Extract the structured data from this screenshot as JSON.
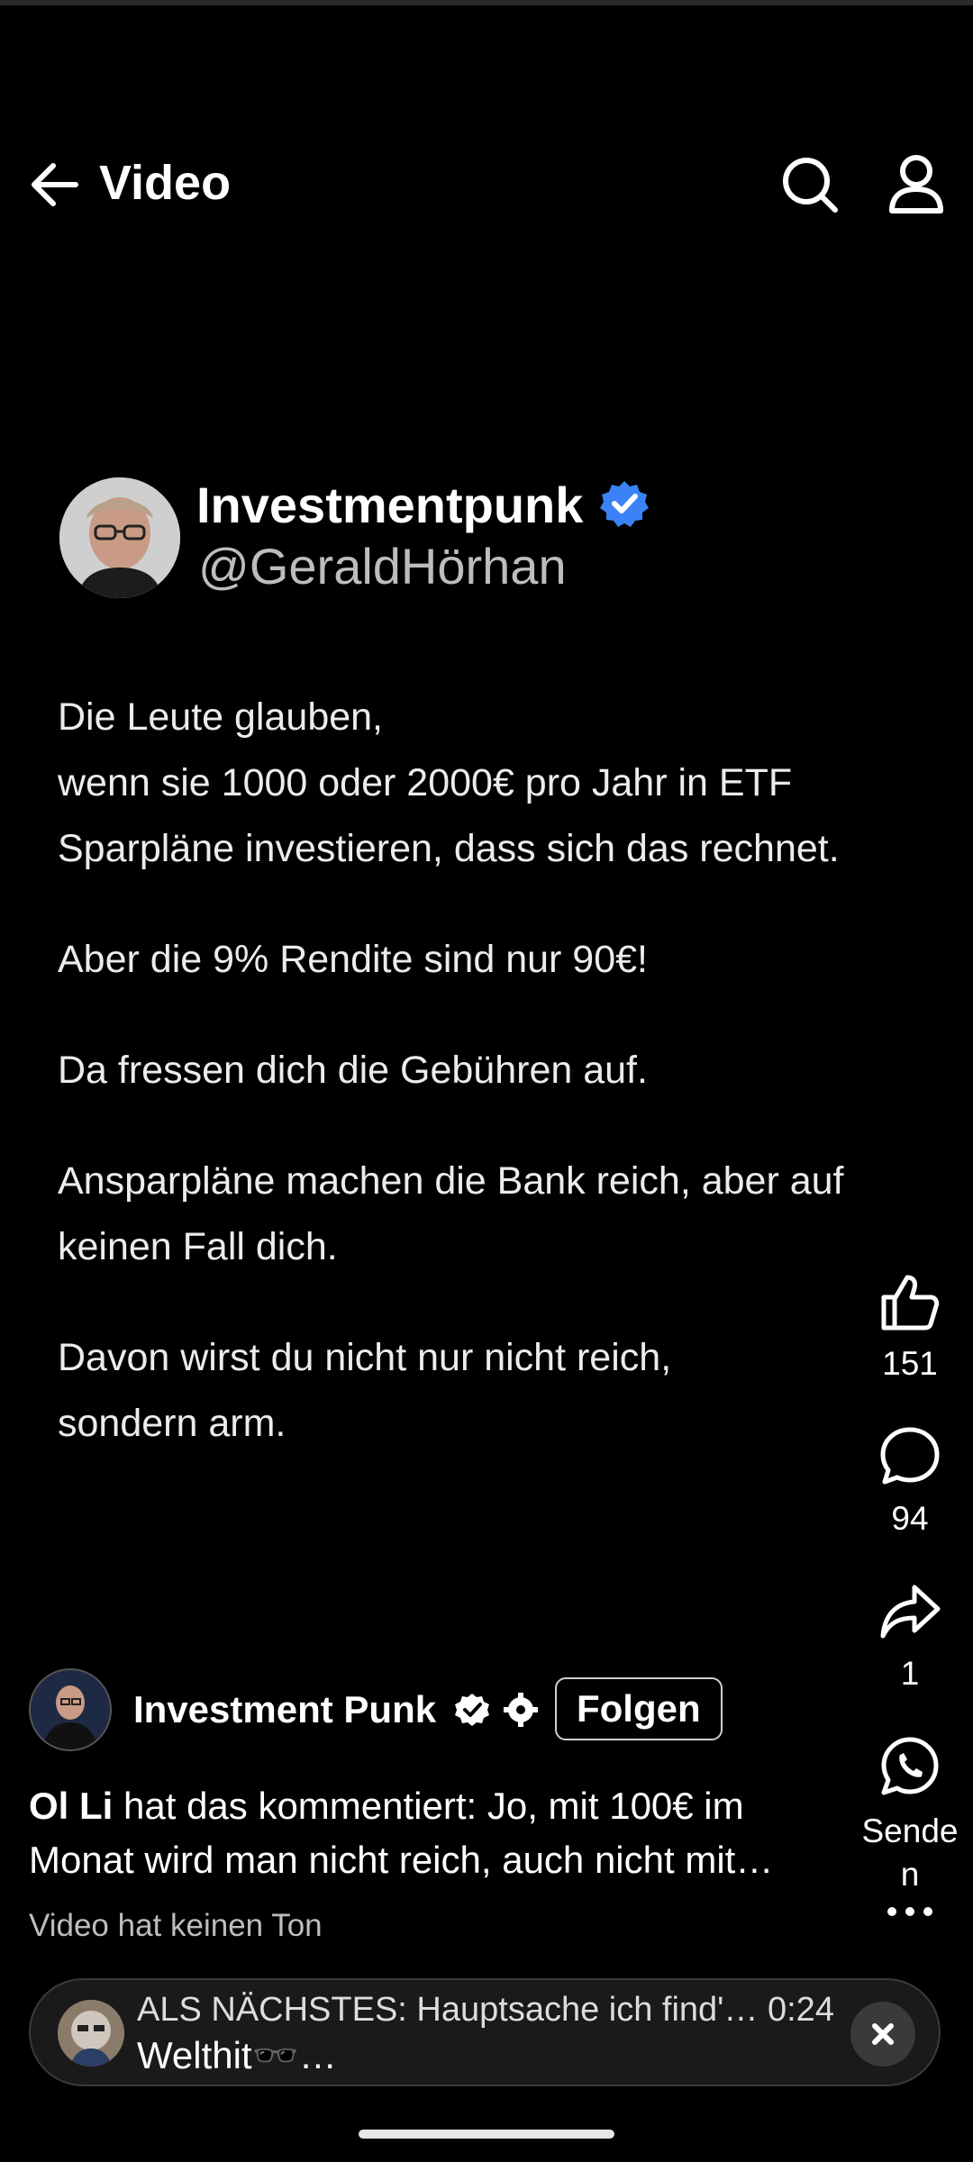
{
  "header": {
    "title": "Video",
    "icons": [
      "back-arrow-icon",
      "search-icon",
      "profile-icon"
    ]
  },
  "post": {
    "author_name": "Investmentpunk",
    "handle": "@GeraldHörhan",
    "paragraphs": [
      "Die Leute glauben,",
      "wenn sie 1000 oder 2000€ pro Jahr in ETF Sparpläne investieren, dass sich das rechnet.",
      "Aber die 9% Rendite sind nur 90€!",
      "Da fressen dich die Gebühren auf.",
      "Ansparpläne machen die Bank reich, aber auf keinen Fall dich.",
      "Davon wirst du nicht nur nicht reich,",
      "sondern arm."
    ]
  },
  "actions": {
    "likes": "151",
    "comments": "94",
    "shares": "1",
    "send_label": "Sende\nn"
  },
  "channel": {
    "name": "Investment Punk",
    "follow_label": "Folgen"
  },
  "comment": {
    "author": "Ol Li",
    "text": " hat das kommentiert: Jo, mit 100€ im Monat wird man nicht reich, auch nicht mit…"
  },
  "sound_notice": "Video hat keinen Ton",
  "up_next": {
    "line1": "ALS NÄCHSTES: Hauptsache ich find'… 0:24",
    "line2": "Welthit🕶️…"
  },
  "colors": {
    "background": "#000000",
    "verified_blue": "#3b82f6",
    "text_secondary": "#bdbdbd"
  }
}
